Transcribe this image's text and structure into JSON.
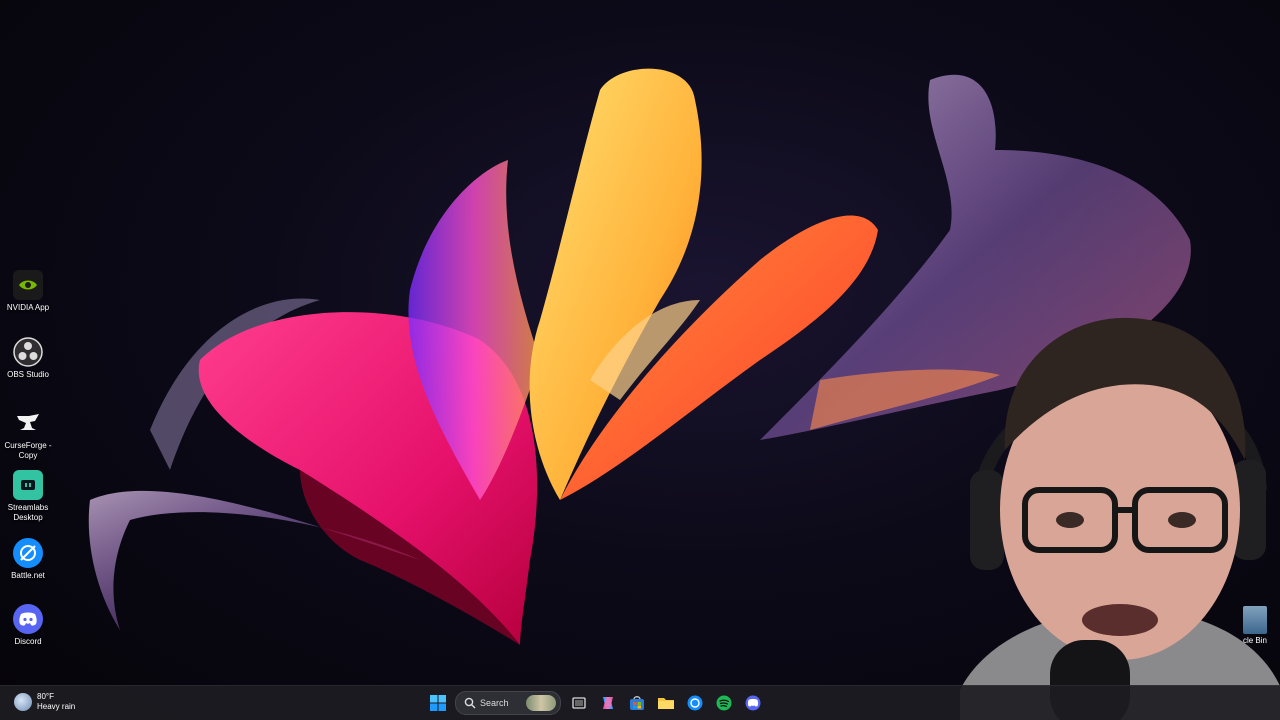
{
  "desktop_icons": [
    {
      "label": "NVIDIA App",
      "icon": "nvidia-icon"
    },
    {
      "label": "OBS Studio",
      "icon": "obs-icon"
    },
    {
      "label": "CurseForge - Copy",
      "icon": "curseforge-icon"
    },
    {
      "label": "Streamlabs Desktop",
      "icon": "streamlabs-icon"
    },
    {
      "label": "Battle.net",
      "icon": "battlenet-icon"
    },
    {
      "label": "Discord",
      "icon": "discord-icon"
    }
  ],
  "recycle_bin": {
    "label": "cle Bin"
  },
  "taskbar": {
    "weather": {
      "temp": "80°F",
      "condition": "Heavy rain"
    },
    "search": {
      "placeholder": "Search"
    },
    "pinned": [
      "windows-start-icon",
      "task-view-icon",
      "copilot-icon",
      "store-icon",
      "file-explorer-icon",
      "battlenet-icon",
      "spotify-icon",
      "discord-icon"
    ]
  },
  "colors": {
    "taskbar_bg": "#1c1c22",
    "nvidia": "#76b900",
    "streamlabs": "#31c3a2",
    "discord": "#5865f2",
    "battlenet": "#148eff",
    "spotify": "#1db954"
  }
}
